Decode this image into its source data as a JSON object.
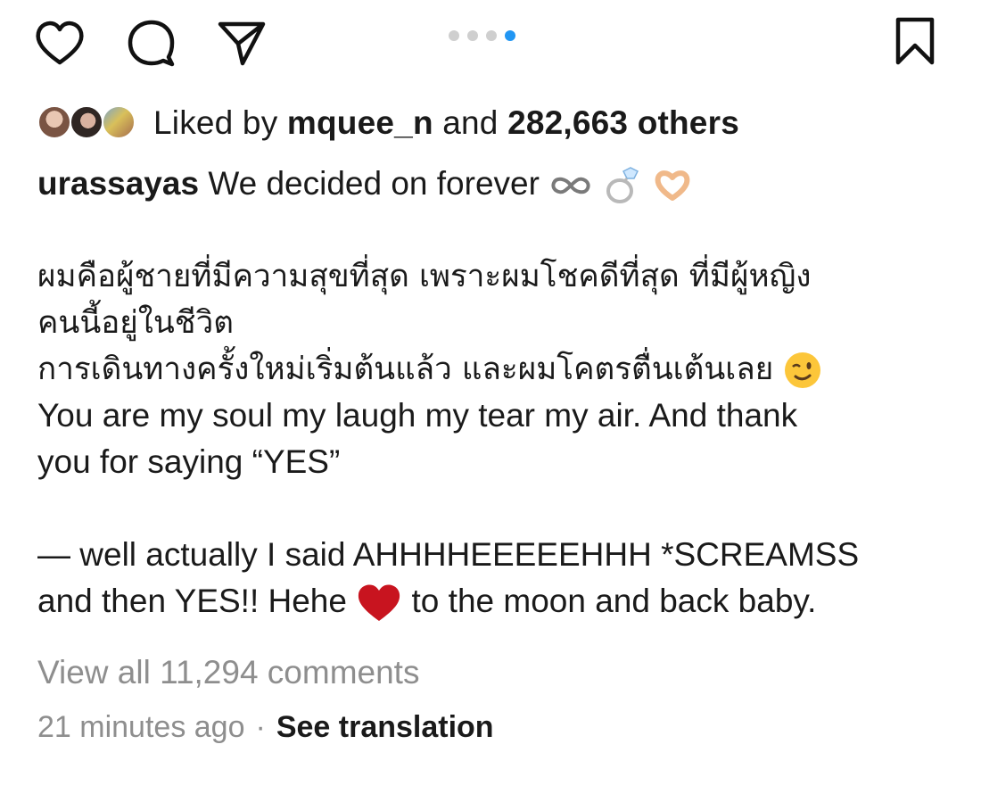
{
  "actions": {
    "like_icon": "heart-outline-icon",
    "comment_icon": "comment-bubble-icon",
    "share_icon": "paper-plane-icon",
    "save_icon": "bookmark-outline-icon"
  },
  "carousel": {
    "total": 4,
    "active_index": 4,
    "active_color": "#2196f3",
    "inactive_color": "#cfcfcf"
  },
  "likes": {
    "prefix": "Liked by",
    "username": "mquee_n",
    "and": "and",
    "count": "282,663 others"
  },
  "caption": {
    "username": "urassayas",
    "first_line_text": "We decided on forever",
    "first_line_emojis": [
      "infinity-icon",
      "ring-icon",
      "heart-hands-icon"
    ],
    "thai_line_1": "ผมคือผู้ชายที่มีความสุขที่สุด เพราะผมโชคดีที่สุด ที่มีผู้หญิง",
    "thai_line_2": "คนนี้อยู่ในชีวิต",
    "thai_line_3": "การเดินทางครั้งใหม่เริ่มต้นแล้ว และผมโคตรตื่นเต้นเลย",
    "thai_line_3_emoji": "winking-face-icon",
    "en_line_1": "You are my soul my laugh my tear my air. And thank",
    "en_line_2": "you for saying “YES”",
    "en_line_3": "— well actually I said AHHHHEEEEEHHH *SCREAMSS",
    "en_line_4a": "and then YES!! Hehe",
    "en_line_4_emoji": "red-heart-icon",
    "en_line_4b": "to the moon and back baby."
  },
  "comments": {
    "view_all": "View all 11,294 comments"
  },
  "meta": {
    "time": "21 minutes ago",
    "separator": "·",
    "see_translation": "See translation"
  }
}
